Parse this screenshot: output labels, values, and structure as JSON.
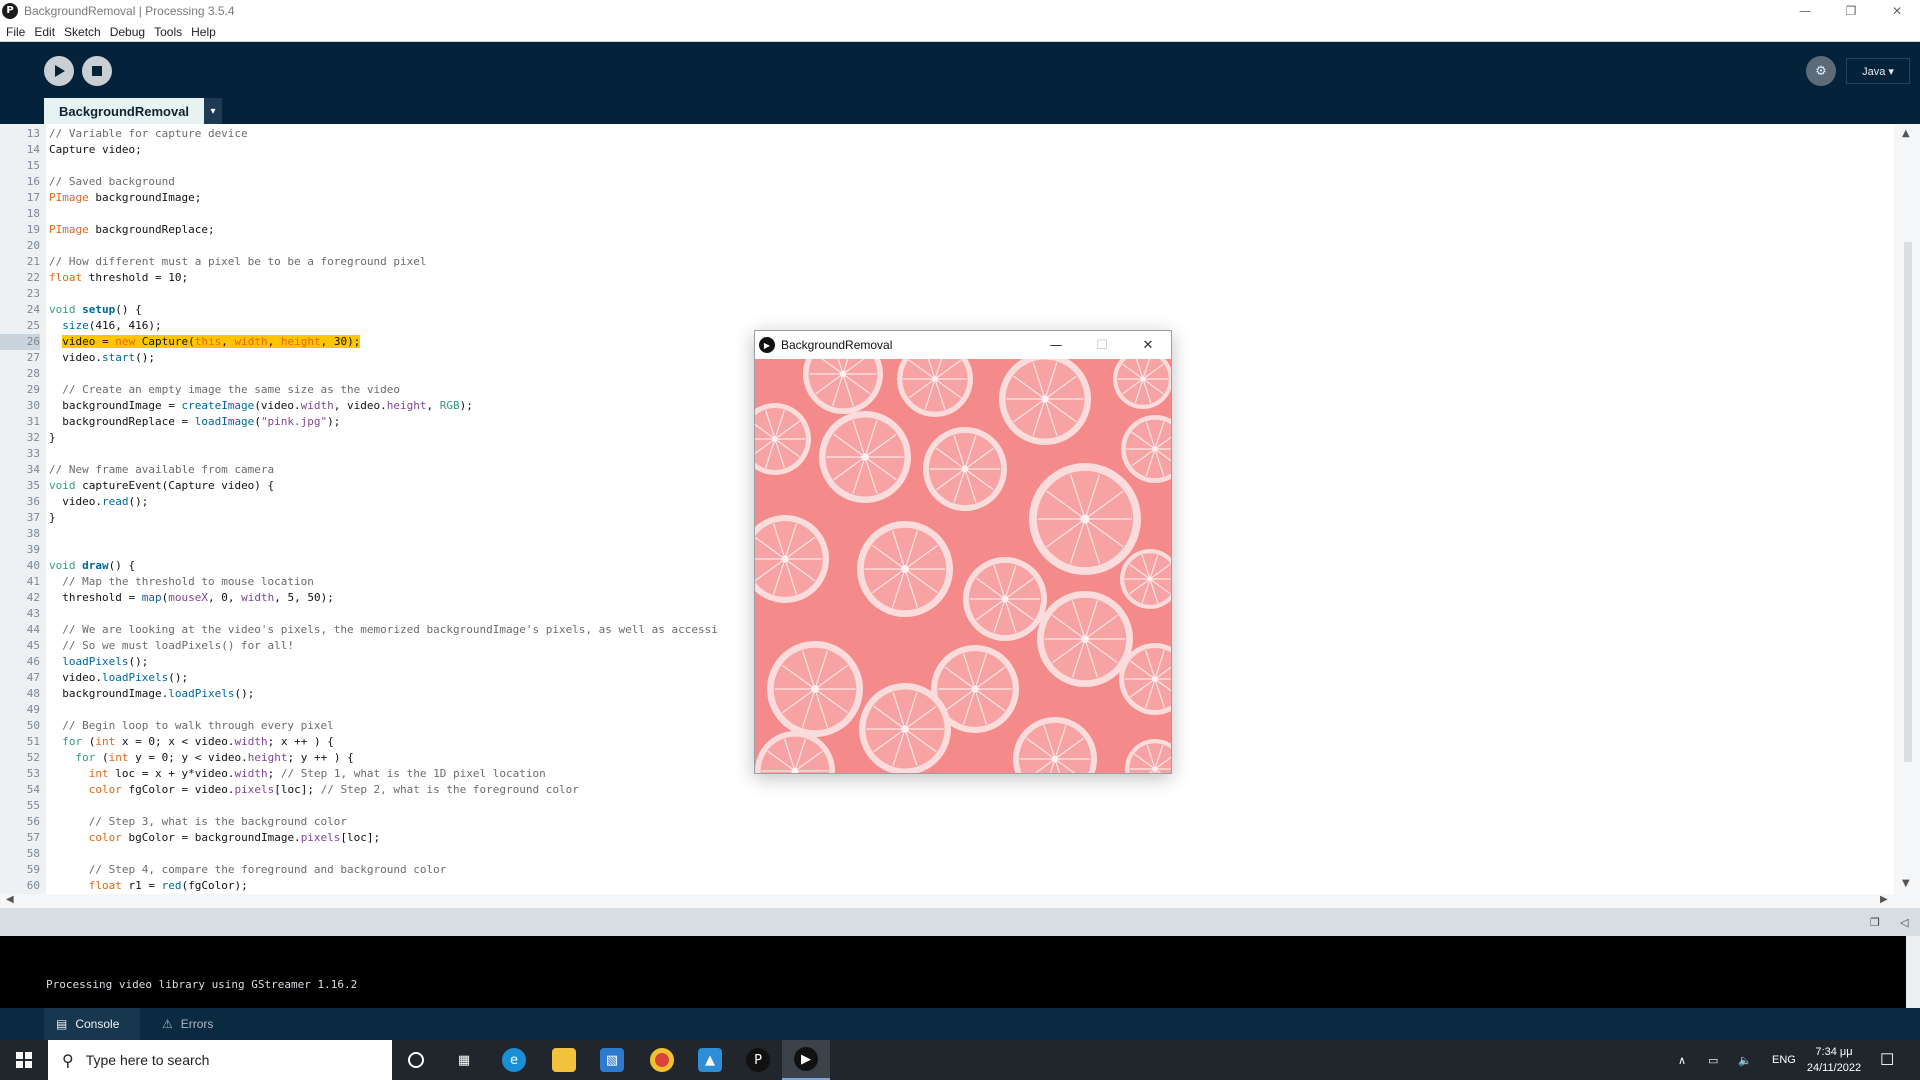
{
  "window": {
    "title": "BackgroundRemoval | Processing 3.5.4",
    "app_icon": "processing-logo",
    "controls": [
      "minimize-icon",
      "restore-icon",
      "close-icon"
    ]
  },
  "menu": [
    "File",
    "Edit",
    "Sketch",
    "Debug",
    "Tools",
    "Help"
  ],
  "toolbar": {
    "run_icon": "play-icon",
    "stop_icon": "stop-icon",
    "debug_icon": "debugger-icon",
    "mode": "Java ▾"
  },
  "editor": {
    "tab_label": "BackgroundRemoval",
    "tab_menu": "▾",
    "current_line": 26,
    "lines": [
      {
        "n": "13",
        "html": "<span class=\"cm\">// Variable for capture device</span>"
      },
      {
        "n": "14",
        "html": "Capture video;"
      },
      {
        "n": "15",
        "html": ""
      },
      {
        "n": "16",
        "html": "<span class=\"cm\">// Saved background</span>"
      },
      {
        "n": "17",
        "html": "<span class=\"ty\">PImage</span> backgroundImage;"
      },
      {
        "n": "18",
        "html": ""
      },
      {
        "n": "19",
        "html": "<span class=\"ty\">PImage</span> backgroundReplace;"
      },
      {
        "n": "20",
        "html": ""
      },
      {
        "n": "21",
        "html": "<span class=\"cm\">// How different must a pixel be to be a foreground pixel</span>"
      },
      {
        "n": "22",
        "html": "<span class=\"ty\">float</span> threshold = 10;"
      },
      {
        "n": "23",
        "html": ""
      },
      {
        "n": "24",
        "html": "<span class=\"kw\">void</span> <span class=\"fn\"><b>setup</b></span>() {"
      },
      {
        "n": "25",
        "html": "  <span class=\"fn\">size</span>(416, 416);"
      },
      {
        "n": "26",
        "html": "  <span class=\"hl\">video = <span class=\"hl-kw\">new</span> Capture(<span class=\"hl-kw\">this</span>, <span class=\"hl-kw\">width</span>, <span class=\"hl-kw\">height</span>, 30);</span>",
        "highlight": true
      },
      {
        "n": "27",
        "html": "  video.<span class=\"fn\">start</span>();"
      },
      {
        "n": "28",
        "html": ""
      },
      {
        "n": "29",
        "html": "  <span class=\"cm\">// Create an empty image the same size as the video</span>"
      },
      {
        "n": "30",
        "html": "  backgroundImage = <span class=\"fn\">createImage</span>(video.<span class=\"st\">width</span>, video.<span class=\"st\">height</span>, <span class=\"kw\">RGB</span>);"
      },
      {
        "n": "31",
        "html": "  backgroundReplace = <span class=\"fn\">loadImage</span>(<span class=\"st\">\"pink.jpg\"</span>);"
      },
      {
        "n": "32",
        "html": "}"
      },
      {
        "n": "33",
        "html": ""
      },
      {
        "n": "34",
        "html": "<span class=\"cm\">// New frame available from camera</span>"
      },
      {
        "n": "35",
        "html": "<span class=\"kw\">void</span> captureEvent(Capture video) {"
      },
      {
        "n": "36",
        "html": "  video.<span class=\"fn\">read</span>();"
      },
      {
        "n": "37",
        "html": "}"
      },
      {
        "n": "38",
        "html": ""
      },
      {
        "n": "39",
        "html": ""
      },
      {
        "n": "40",
        "html": "<span class=\"kw\">void</span> <span class=\"fn\"><b>draw</b></span>() {"
      },
      {
        "n": "41",
        "html": "  <span class=\"cm\">// Map the threshold to mouse location</span>"
      },
      {
        "n": "42",
        "html": "  threshold = <span class=\"fn\">map</span>(<span class=\"st\">mouseX</span>, 0, <span class=\"st\">width</span>, 5, 50);"
      },
      {
        "n": "43",
        "html": ""
      },
      {
        "n": "44",
        "html": "  <span class=\"cm\">// We are looking at the video's pixels, the memorized backgroundImage's pixels, as well as accessi</span>"
      },
      {
        "n": "45",
        "html": "  <span class=\"cm\">// So we must loadPixels() for all!</span>"
      },
      {
        "n": "46",
        "html": "  <span class=\"fn\">loadPixels</span>();"
      },
      {
        "n": "47",
        "html": "  video.<span class=\"fn\">loadPixels</span>();"
      },
      {
        "n": "48",
        "html": "  backgroundImage.<span class=\"fn\">loadPixels</span>();"
      },
      {
        "n": "49",
        "html": ""
      },
      {
        "n": "50",
        "html": "  <span class=\"cm\">// Begin loop to walk through every pixel</span>"
      },
      {
        "n": "51",
        "html": "  <span class=\"kw\">for</span> (<span class=\"ty\">int</span> x = 0; x &lt; video.<span class=\"st\">width</span>; x ++ ) {"
      },
      {
        "n": "52",
        "html": "    <span class=\"kw\">for</span> (<span class=\"ty\">int</span> y = 0; y &lt; video.<span class=\"st\">height</span>; y ++ ) {"
      },
      {
        "n": "53",
        "html": "      <span class=\"ty\">int</span> loc = x + y*video.<span class=\"st\">width</span>; <span class=\"cm\">// Step 1, what is the 1D pixel location</span>"
      },
      {
        "n": "54",
        "html": "      <span class=\"ty\">color</span> fgColor = video.<span class=\"st\">pixels</span>[loc]; <span class=\"cm\">// Step 2, what is the foreground color</span>"
      },
      {
        "n": "55",
        "html": ""
      },
      {
        "n": "56",
        "html": "      <span class=\"cm\">// Step 3, what is the background color</span>"
      },
      {
        "n": "57",
        "html": "      <span class=\"ty\">color</span> bgColor = backgroundImage.<span class=\"st\">pixels</span>[loc];"
      },
      {
        "n": "58",
        "html": ""
      },
      {
        "n": "59",
        "html": "      <span class=\"cm\">// Step 4, compare the foreground and background color</span>"
      },
      {
        "n": "60",
        "html": "      <span class=\"ty\">float</span> r1 = <span class=\"fn\">red</span>(fgColor);"
      }
    ]
  },
  "console": {
    "message": "Processing video library using GStreamer 1.16.2",
    "tabs": [
      {
        "label": "Console",
        "icon": "console-icon",
        "active": true
      },
      {
        "label": "Errors",
        "icon": "warning-icon",
        "active": false
      }
    ]
  },
  "sketch_window": {
    "title": "BackgroundRemoval",
    "icon": "processing-run-icon",
    "controls": [
      "minimize-icon",
      "maximize-icon",
      "close-icon"
    ],
    "canvas_color": "#f48a8a",
    "content": "sliced-grapefruit-background"
  },
  "taskbar": {
    "search_placeholder": "Type here to search",
    "apps": [
      "cortana-icon",
      "task-view-icon",
      "edge-icon",
      "file-explorer-icon",
      "store-icon",
      "chrome-icon",
      "photos-icon",
      "processing-icon",
      "processing-run-icon"
    ],
    "language": "ENG",
    "time": "7:34 μμ",
    "date": "24/11/2022"
  },
  "colors": {
    "toolbar_bg": "#04233a",
    "tab_active_bg": "#e5f4f2",
    "line_highlight": "#ffc600",
    "comment": "#6b6b6b",
    "keyword": "#33997e",
    "type": "#e2661a",
    "function": "#006699",
    "console_bg": "#000000",
    "taskbar_bg": "#20262c"
  }
}
